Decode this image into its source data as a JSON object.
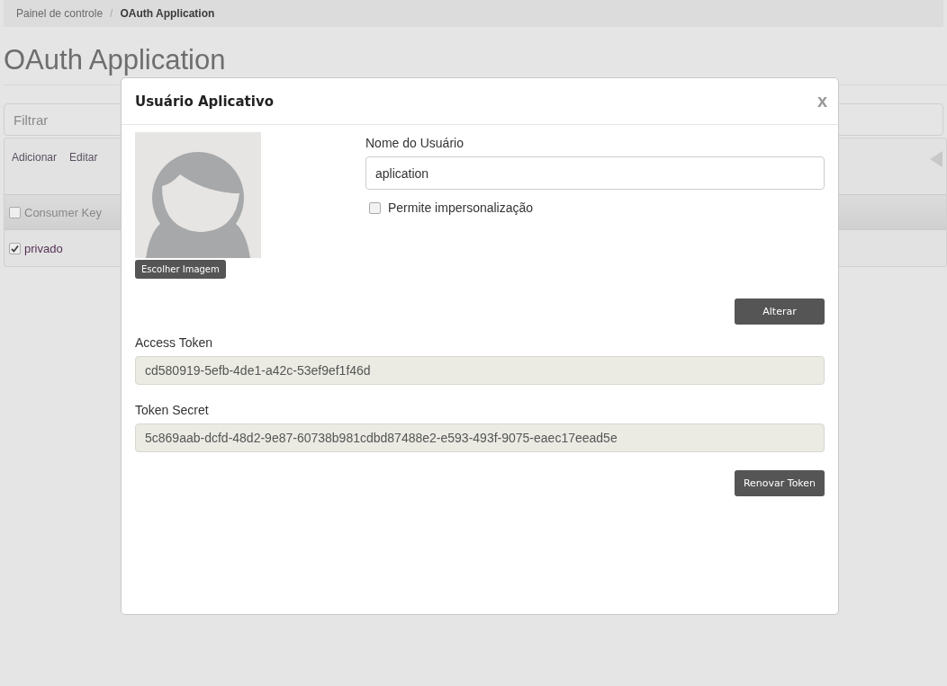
{
  "breadcrumb": [
    {
      "label": "Painel de controle",
      "selected": false
    },
    {
      "label": "OAuth Application",
      "selected": true
    }
  ],
  "breadcrumb_separator": "/",
  "page_title": "OAuth Application",
  "filter": {
    "placeholder": "Filtrar"
  },
  "toolbar": [
    "Adicionar",
    "Editar"
  ],
  "table": {
    "header": {
      "label": "Consumer Key",
      "checked": false
    },
    "rows": [
      {
        "label": "privado",
        "checked": true
      }
    ]
  },
  "dialog": {
    "title": "Usuário Aplicativo",
    "close": "x",
    "choose_image": "Escolher Imagem",
    "user_name_label": "Nome do Usuário",
    "user_name": "aplication",
    "impersonation": {
      "label": "Permite impersonalização",
      "checked": false
    },
    "change_button": "Alterar",
    "access_token_label": "Access Token",
    "access_token": "cd580919-5efb-4de1-a42c-53ef9ef1f46d",
    "token_secret_label": "Token Secret",
    "token_secret": "5c869aab-dcfd-48d2-9e87-60738b981cdbd87488e2-e593-493f-9075-eaec17eead5e",
    "renew_button": "Renovar Token"
  }
}
